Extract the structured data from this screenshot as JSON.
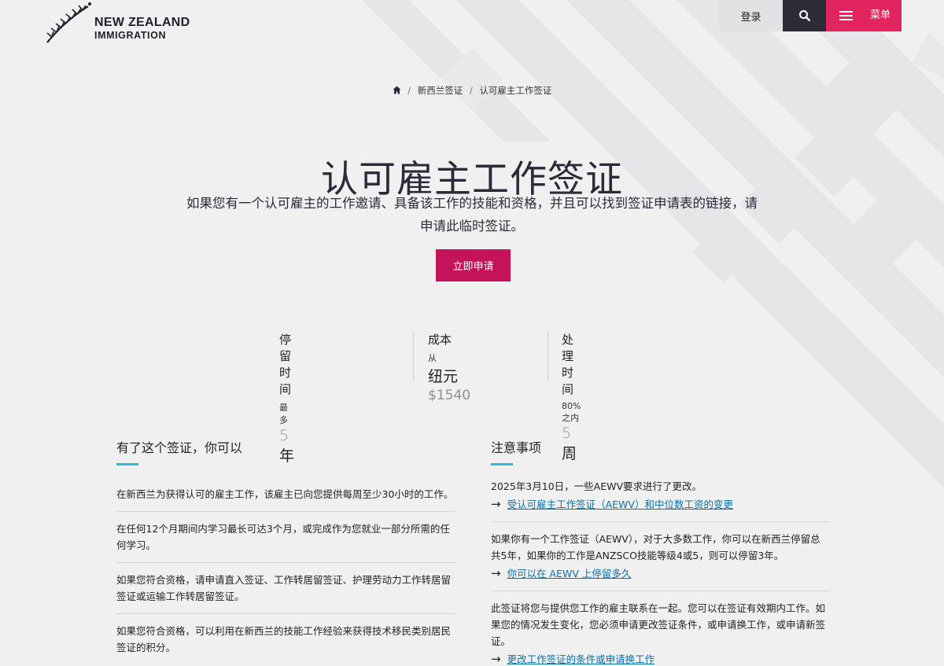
{
  "logo": {
    "line1": "NEW ZEALAND",
    "line2": "IMMIGRATION"
  },
  "topbar": {
    "login": "登录",
    "menu": "菜单"
  },
  "breadcrumb": {
    "items": [
      "新西兰签证",
      "认可雇主工作签证"
    ]
  },
  "title": "认可雇主工作签证",
  "intro": "如果您有一个认可雇主的工作邀请、具备该工作的技能和资格，并且可以找到签证申请表的链接，请申请此临时签证。",
  "apply_button": "立即申请",
  "stats": {
    "stay": {
      "label": "停留时间",
      "prefix": "最多",
      "number": "5",
      "unit": "年"
    },
    "cost": {
      "label": "成本",
      "prefix": "从",
      "currency": "纽元",
      "amount": "$1540"
    },
    "processing": {
      "label": "处理时间",
      "prefix": "80% 之内",
      "number": "5",
      "unit": "周"
    }
  },
  "can_do": {
    "heading": "有了这个签证，你可以",
    "items": [
      "在新西兰为获得认可的雇主工作，该雇主已向您提供每周至少30小时的工作。",
      "在任何12个月期间内学习最长可达3个月，或完成作为您就业一部分所需的任何学习。",
      "如果您符合资格，请申请直入签证、工作转居留签证、护理劳动力工作转居留签证或运输工作转居留签证。",
      "如果您符合资格，可以利用在新西兰的技能工作经验来获得技术移民类别居民签证的积分。"
    ]
  },
  "notes": {
    "heading": "注意事项",
    "items": [
      {
        "text": "2025年3月10日，一些AEWV要求进行了更改。",
        "link": "受认可雇主工作签证（AEWV）和中位数工资的变更"
      },
      {
        "text": "如果你有一个工作签证（AEWV），对于大多数工作，你可以在新西兰停留总共5年，如果你的工作是ANZSCO技能等级4或5，则可以停留3年。",
        "link": "你可以在 AEWV 上停留多久"
      },
      {
        "text": "此签证将您与提供您工作的雇主联系在一起。您可以在签证有效期内工作。如果您的情况发生变化，您必须申请更改签证条件，或申请换工作，或申请新签证。",
        "link": "更改工作签证的条件或申请换工作"
      }
    ]
  },
  "colors": {
    "accent_pink": "#e2245f",
    "button": "#c5135a",
    "dark": "#2b2c37",
    "underline": "#2fb6d8",
    "link": "#0a6fa8"
  }
}
